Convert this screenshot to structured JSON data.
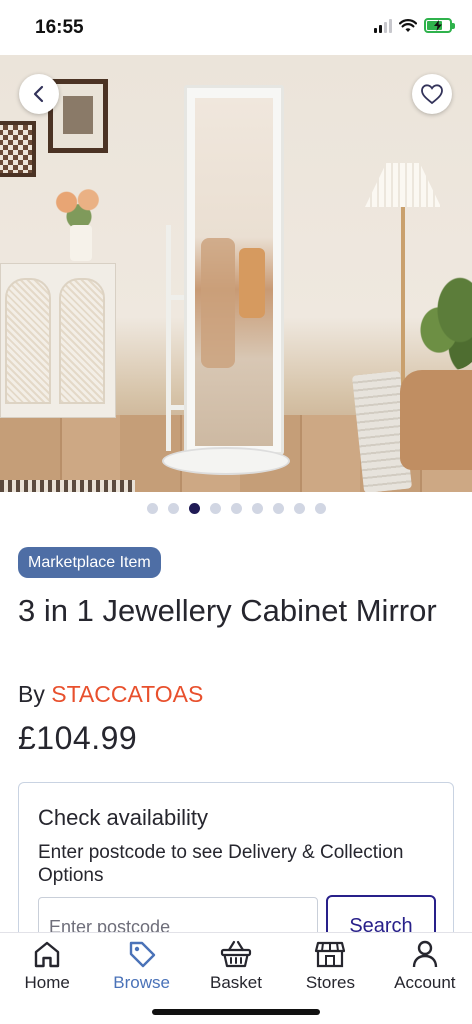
{
  "status_bar": {
    "time": "16:55",
    "icons": [
      "signal-icon",
      "wifi-icon",
      "battery-charging-icon"
    ]
  },
  "hero": {
    "carousel": {
      "count": 9,
      "active_index": 2
    },
    "icons": {
      "back": "chevron-left-icon",
      "favourite": "heart-outline-icon"
    }
  },
  "product": {
    "badge": "Marketplace Item",
    "title": "3 in 1 Jewellery Cabinet Mirror",
    "seller_prefix": "By",
    "seller_name": "STACCATOAS",
    "price": "£104.99"
  },
  "availability": {
    "title": "Check availability",
    "description": "Enter postcode to see Delivery & Collection Options",
    "postcode_placeholder": "Enter postcode",
    "postcode_value": "",
    "search_label": "Search"
  },
  "nav": {
    "items": [
      {
        "label": "Home",
        "icon": "home-icon",
        "active": false
      },
      {
        "label": "Browse",
        "icon": "tag-icon",
        "active": true
      },
      {
        "label": "Basket",
        "icon": "basket-icon",
        "active": false
      },
      {
        "label": "Stores",
        "icon": "store-icon",
        "active": false
      },
      {
        "label": "Account",
        "icon": "account-icon",
        "active": false
      }
    ]
  },
  "colors": {
    "badge_bg": "#4e6ea5",
    "seller_name": "#e8502d",
    "search_button": "#28208a",
    "nav_active": "#4a72b8",
    "dot_active": "#1f1a55",
    "dot_inactive": "#d1d6e3"
  }
}
